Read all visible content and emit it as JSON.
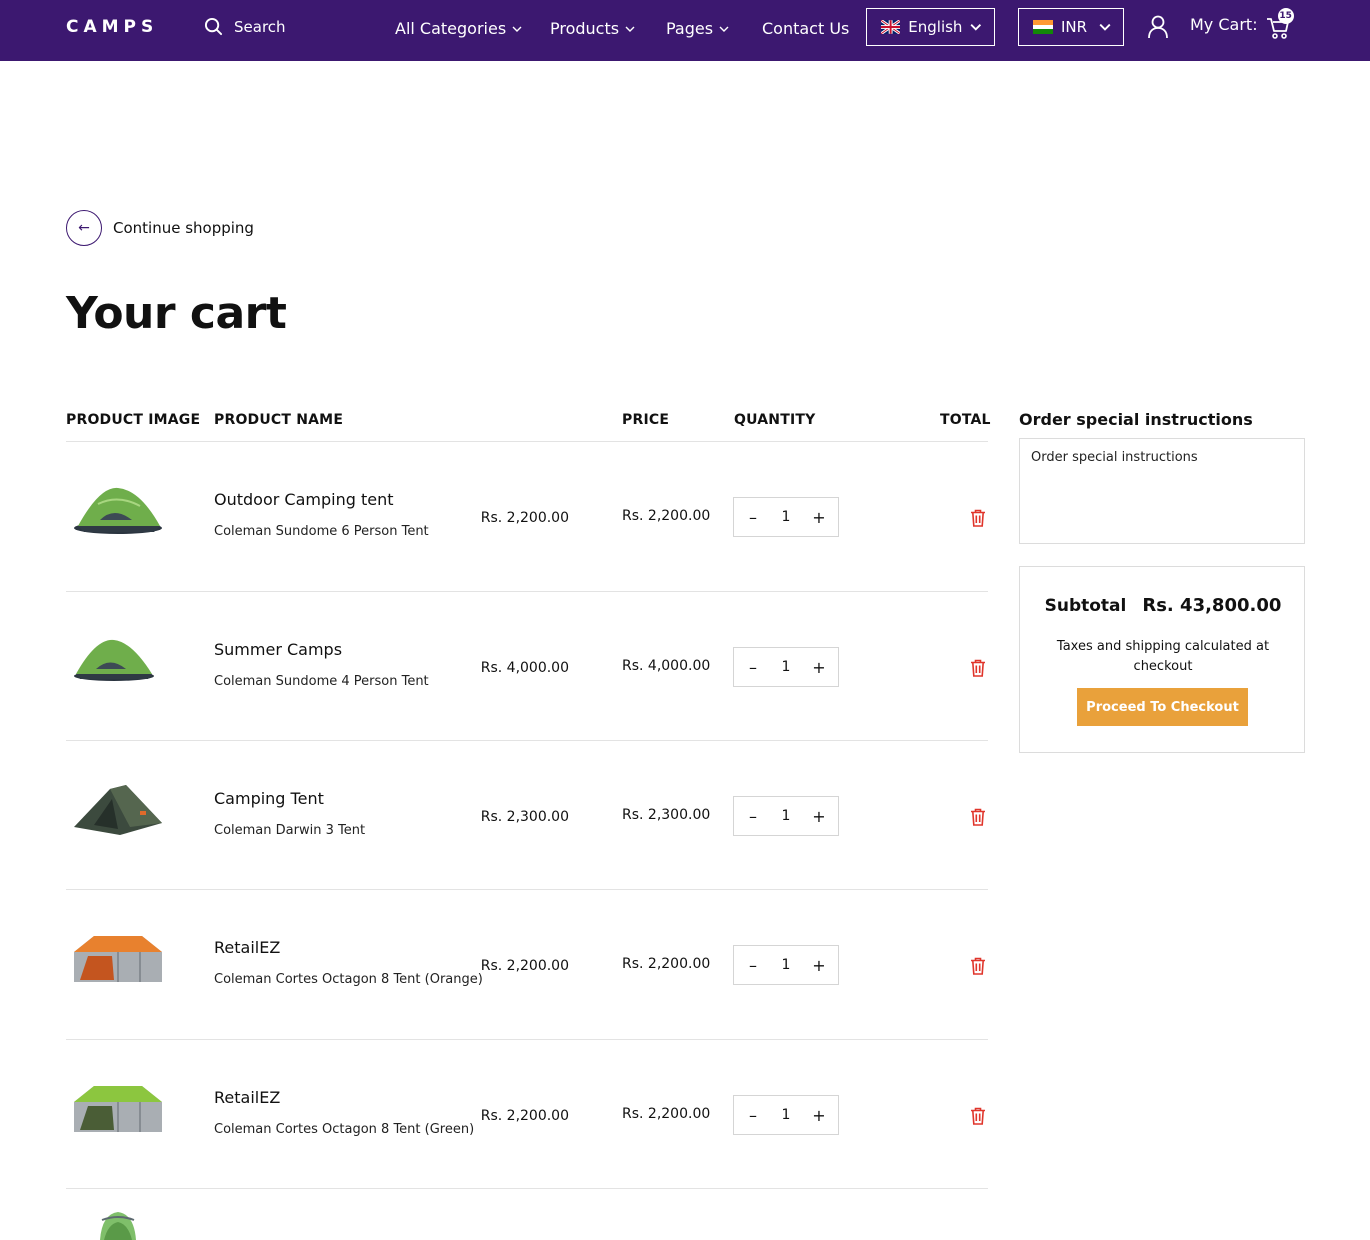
{
  "header": {
    "logo": "CAMPS",
    "search_label": "Search",
    "nav": [
      {
        "label": "All Categories"
      },
      {
        "label": "Products"
      },
      {
        "label": "Pages"
      },
      {
        "label": "Contact Us"
      }
    ],
    "language": "English",
    "currency": "INR",
    "cart_label": "My Cart:",
    "cart_count": "15",
    "bg_color": "#3c1870"
  },
  "page": {
    "continue_shopping": "Continue shopping",
    "title": "Your cart"
  },
  "table": {
    "headers": {
      "image": "PRODUCT IMAGE",
      "name": "PRODUCT NAME",
      "price": "PRICE",
      "quantity": "QUANTITY",
      "total": "TOTAL"
    },
    "rows": [
      {
        "name": "Outdoor Camping tent",
        "variant": "Coleman Sundome 6 Person Tent",
        "price": "Rs. 2,200.00",
        "qty": "1",
        "total": "Rs. 2,200.00",
        "image": "tent-green-dome-icon"
      },
      {
        "name": "Summer Camps",
        "variant": "Coleman Sundome 4 Person Tent",
        "price": "Rs. 4,000.00",
        "qty": "1",
        "total": "Rs. 4,000.00",
        "image": "tent-green-dome-icon"
      },
      {
        "name": "Camping Tent",
        "variant": "Coleman Darwin 3 Tent",
        "price": "Rs. 2,300.00",
        "qty": "1",
        "total": "Rs. 2,300.00",
        "image": "tent-dark-green-icon"
      },
      {
        "name": "RetailEZ",
        "variant": "Coleman Cortes Octagon 8 Tent (Orange)",
        "price": "Rs. 2,200.00",
        "qty": "1",
        "total": "Rs. 2,200.00",
        "image": "tent-orange-octagon-icon"
      },
      {
        "name": "RetailEZ",
        "variant": "Coleman Cortes Octagon 8 Tent (Green)",
        "price": "Rs. 2,200.00",
        "qty": "1",
        "total": "Rs. 2,200.00",
        "image": "tent-green-octagon-icon"
      }
    ]
  },
  "sidebar": {
    "instructions_title": "Order special instructions",
    "instructions_placeholder": "Order special instructions",
    "subtotal_label": "Subtotal",
    "subtotal_value": "Rs. 43,800.00",
    "tax_note": "Taxes and shipping calculated at checkout",
    "checkout_label": "Proceed To Checkout",
    "checkout_color": "#e9a13b"
  }
}
